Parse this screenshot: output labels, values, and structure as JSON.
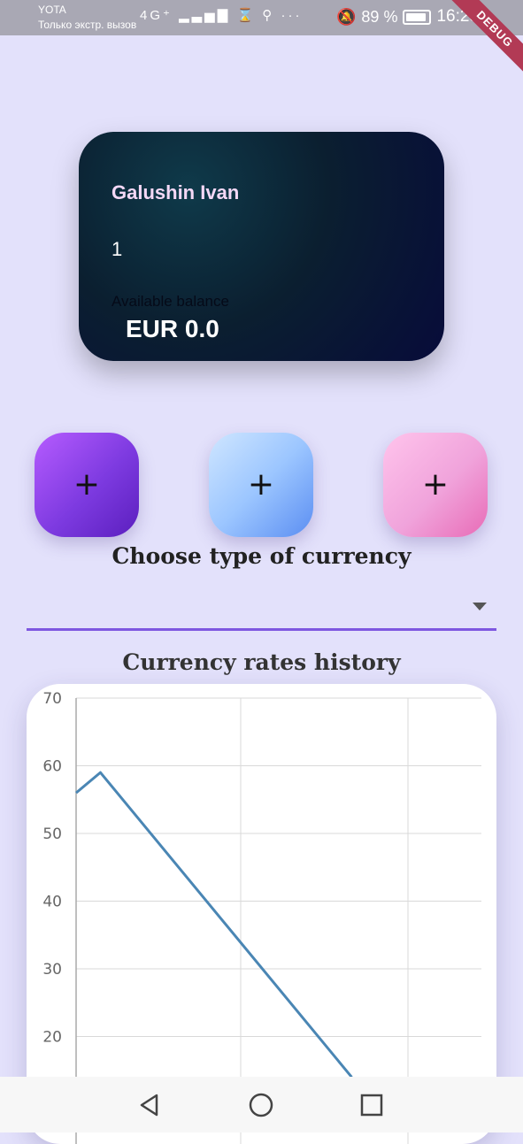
{
  "status_bar": {
    "carrier": "YOTA",
    "carrier_sub": "Только экстр. вызов",
    "network": "4G⁺",
    "battery_percent": "89 %",
    "time": "16:28",
    "debug_label": "DEBUG"
  },
  "card": {
    "holder_name": "Galushin Ivan",
    "number": "1",
    "available_label": "Available balance",
    "balance": "EUR 0.0"
  },
  "actions": {
    "buttons": [
      {
        "label": "+",
        "color": "#8a44ea"
      },
      {
        "label": "+",
        "color": "#8fbaf8"
      },
      {
        "label": "+",
        "color": "#f0a0d8"
      }
    ]
  },
  "currency_select": {
    "heading": "Choose type of currency",
    "selected_value": "",
    "accent": "#7e57e0"
  },
  "chart_section": {
    "heading": "Currency rates history"
  },
  "chart_data": {
    "type": "line",
    "title": "",
    "xlabel": "",
    "ylabel": "",
    "yticks": [
      20,
      30,
      40,
      50,
      60,
      70
    ],
    "ylim": [
      14,
      70
    ],
    "xlim": [
      0,
      5
    ],
    "grid": true,
    "series": [
      {
        "x": [
          0,
          0.3,
          3.4
        ],
        "y": [
          56,
          59,
          14
        ],
        "color": "#4a86b4"
      }
    ]
  },
  "nav_bar": {
    "back": "back-icon",
    "home": "home-icon",
    "recent": "recent-apps-icon"
  }
}
